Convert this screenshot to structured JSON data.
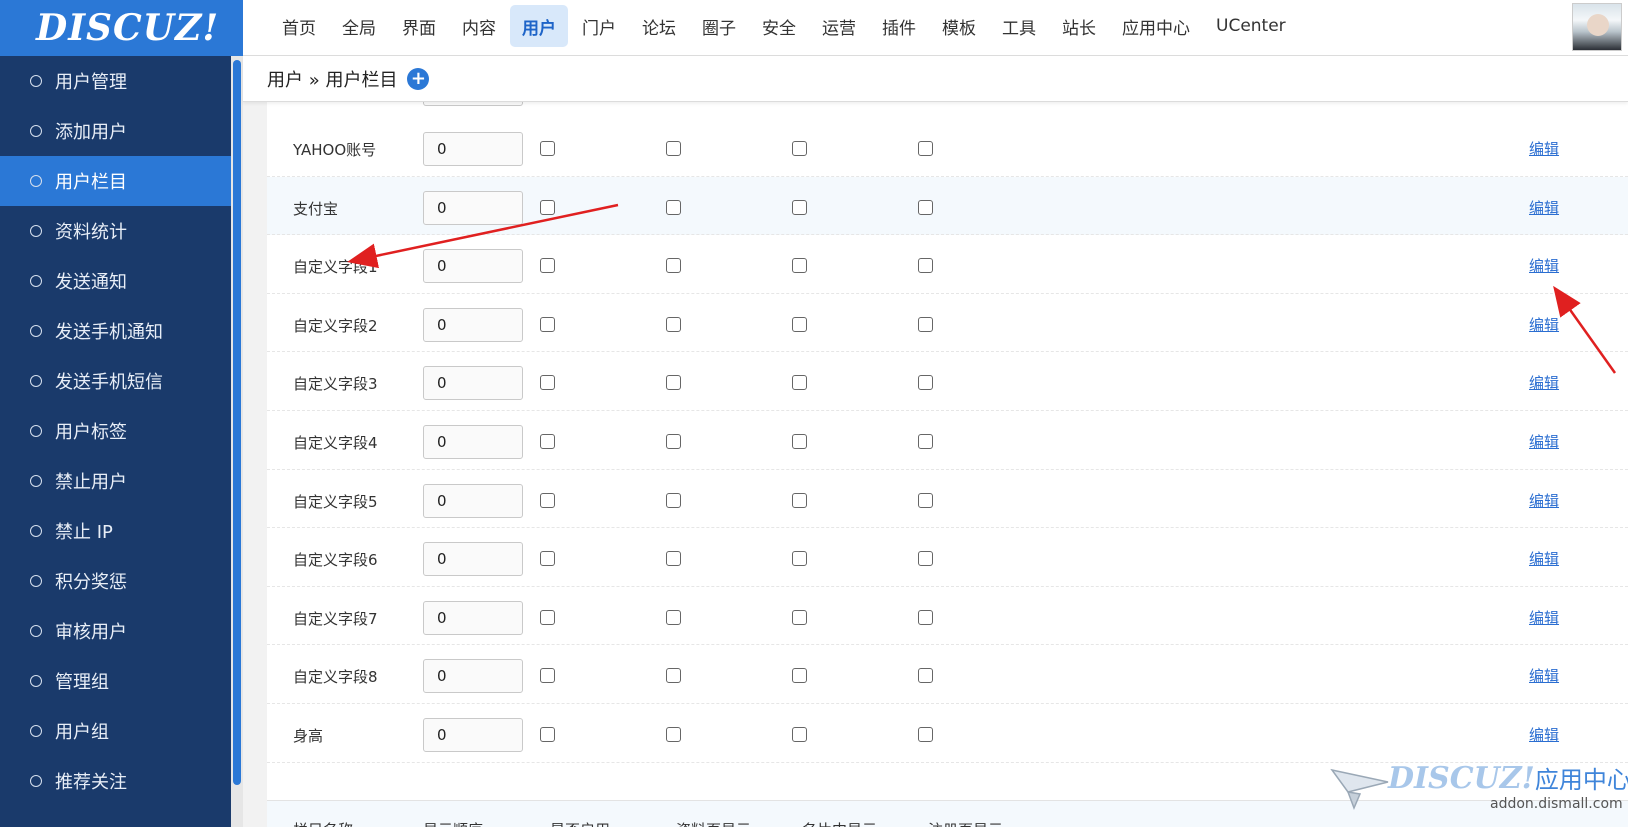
{
  "logo": "DISCUZ!",
  "nav": [
    "首页",
    "全局",
    "界面",
    "内容",
    "用户",
    "门户",
    "论坛",
    "圈子",
    "安全",
    "运营",
    "插件",
    "模板",
    "工具",
    "站长",
    "应用中心",
    "UCenter"
  ],
  "nav_active": "用户",
  "sidebar": [
    "用户管理",
    "添加用户",
    "用户栏目",
    "资料统计",
    "发送通知",
    "发送手机通知",
    "发送手机短信",
    "用户标签",
    "禁止用户",
    "禁止 IP",
    "积分奖惩",
    "审核用户",
    "管理组",
    "用户组",
    "推荐关注"
  ],
  "sidebar_active": "用户栏目",
  "breadcrumb": "用户 » 用户栏目",
  "edit_label": "编辑",
  "rows": [
    {
      "label": "YAHOO账号",
      "order": "0"
    },
    {
      "label": "支付宝",
      "order": "0"
    },
    {
      "label": "自定义字段1",
      "order": "0"
    },
    {
      "label": "自定义字段2",
      "order": "0"
    },
    {
      "label": "自定义字段3",
      "order": "0"
    },
    {
      "label": "自定义字段4",
      "order": "0"
    },
    {
      "label": "自定义字段5",
      "order": "0"
    },
    {
      "label": "自定义字段6",
      "order": "0"
    },
    {
      "label": "自定义字段7",
      "order": "0"
    },
    {
      "label": "自定义字段8",
      "order": "0"
    },
    {
      "label": "身高",
      "order": "0"
    }
  ],
  "columns": [
    "栏目名称",
    "显示顺序",
    "是否启用",
    "资料页显示",
    "名片中显示",
    "注册页显示"
  ],
  "watermark": {
    "brand": "DISCUZ!",
    "suffix": "应用中心",
    "url": "addon.dismall.com"
  },
  "colors": {
    "accent": "#2b78d6",
    "sidebar": "#1a3a6b",
    "arrow": "#e02020",
    "link": "#2b6ed1"
  }
}
